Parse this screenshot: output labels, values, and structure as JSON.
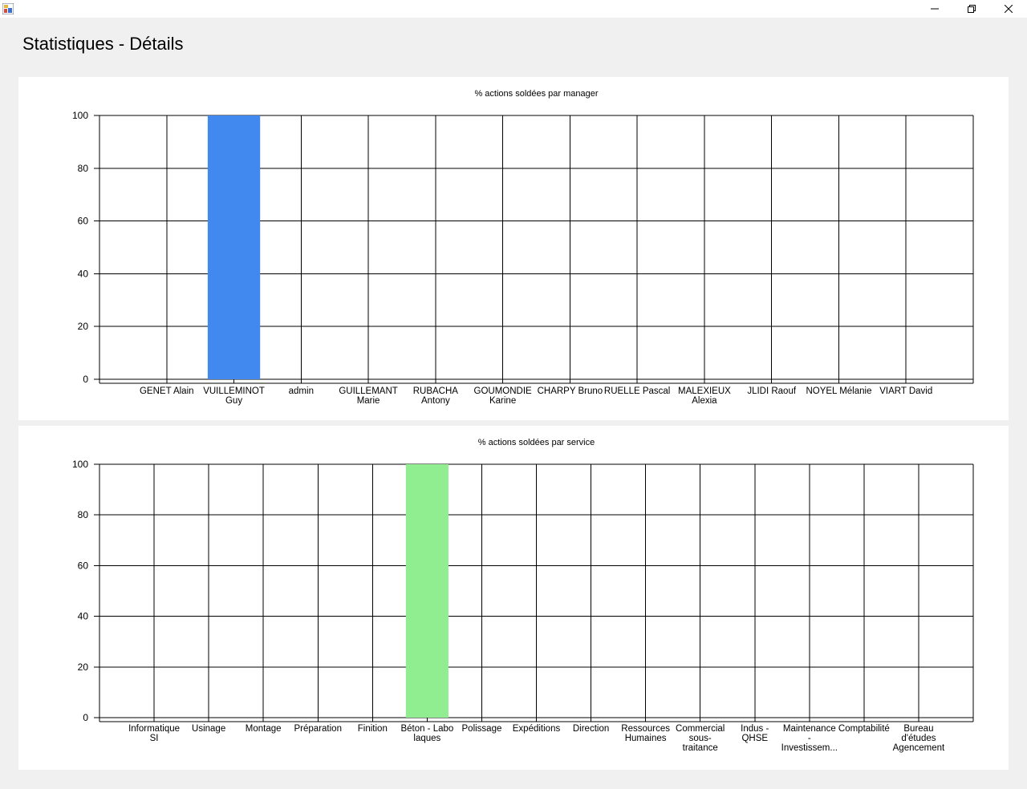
{
  "window": {
    "title": "Statistiques - Détails",
    "min_icon": "minimize-icon",
    "max_icon": "restore-icon",
    "close_icon": "close-icon"
  },
  "chart_data": [
    {
      "type": "bar",
      "title": "% actions soldées par manager",
      "categories": [
        "GENET Alain",
        "VUILLEMINOT Guy",
        "admin",
        "GUILLEMANT Marie",
        "RUBACHA Antony",
        "GOUMONDIE Karine",
        "CHARPY Bruno",
        "RUELLE Pascal",
        "MALEXIEUX Alexia",
        "JLIDI Raouf",
        "NOYEL Mélanie",
        "VIART David"
      ],
      "label_lines": [
        [
          "GENET Alain"
        ],
        [
          "VUILLEMINOT",
          "Guy"
        ],
        [
          "admin"
        ],
        [
          "GUILLEMANT",
          "Marie"
        ],
        [
          "RUBACHA",
          "Antony"
        ],
        [
          "GOUMONDIE",
          "Karine"
        ],
        [
          "CHARPY Bruno"
        ],
        [
          "RUELLE Pascal"
        ],
        [
          "MALEXIEUX",
          "Alexia"
        ],
        [
          "JLIDI Raouf"
        ],
        [
          "NOYEL Mélanie"
        ],
        [
          "VIART David"
        ]
      ],
      "values": [
        0,
        100,
        0,
        0,
        0,
        0,
        0,
        0,
        0,
        0,
        0,
        0
      ],
      "ylim": [
        0,
        100
      ],
      "yticks": [
        0,
        20,
        40,
        60,
        80,
        100
      ],
      "grid": true,
      "color": "#4189EE"
    },
    {
      "type": "bar",
      "title": "% actions soldées par service",
      "categories": [
        "Informatique SI",
        "Usinage",
        "Montage",
        "Préparation",
        "Finition",
        "Béton - Labo laques",
        "Polissage",
        "Expéditions",
        "Direction",
        "Ressources Humaines",
        "Commercial sous-traitance",
        "Indus - QHSE",
        "Maintenance - Investissem...",
        "Comptabilité",
        "Bureau d'études Agencement"
      ],
      "label_lines": [
        [
          "Informatique",
          "SI"
        ],
        [
          "Usinage"
        ],
        [
          "Montage"
        ],
        [
          "Préparation"
        ],
        [
          "Finition"
        ],
        [
          "Béton - Labo",
          "laques"
        ],
        [
          "Polissage"
        ],
        [
          "Expéditions"
        ],
        [
          "Direction"
        ],
        [
          "Ressources",
          "Humaines"
        ],
        [
          "Commercial",
          "sous-",
          "traitance"
        ],
        [
          "Indus -",
          "QHSE"
        ],
        [
          "Maintenance",
          "-",
          "Investissem..."
        ],
        [
          "Comptabilité"
        ],
        [
          "Bureau",
          "d'études",
          "Agencement"
        ]
      ],
      "values": [
        0,
        0,
        0,
        0,
        0,
        100,
        0,
        0,
        0,
        0,
        0,
        0,
        0,
        0,
        0
      ],
      "ylim": [
        0,
        100
      ],
      "yticks": [
        0,
        20,
        40,
        60,
        80,
        100
      ],
      "grid": true,
      "color": "#90EE90"
    }
  ]
}
